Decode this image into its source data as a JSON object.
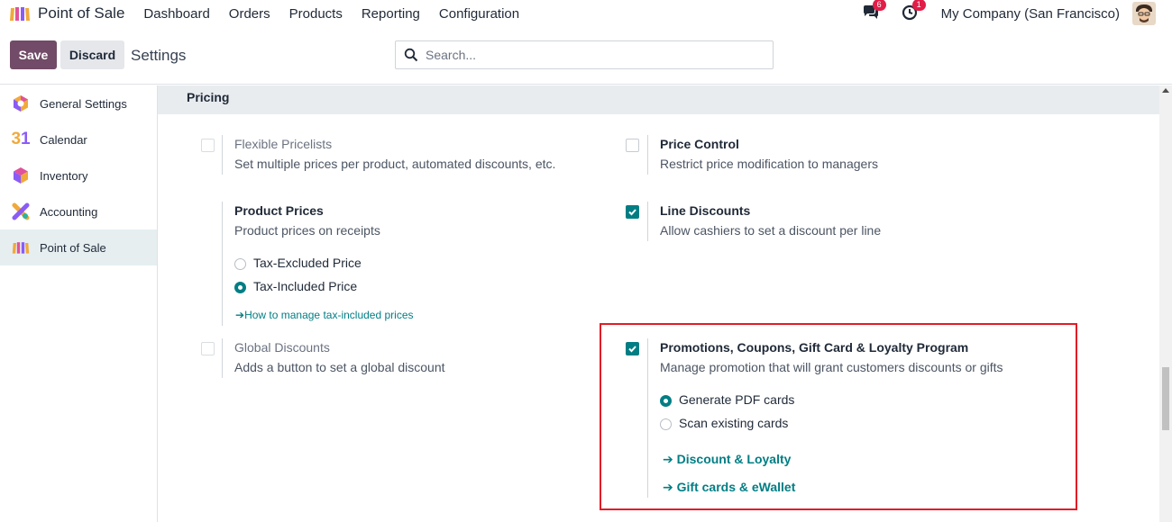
{
  "navbar": {
    "app_name": "Point of Sale",
    "menu": [
      "Dashboard",
      "Orders",
      "Products",
      "Reporting",
      "Configuration"
    ],
    "messages_count": "6",
    "activities_count": "1",
    "company": "My Company (San Francisco)"
  },
  "control": {
    "save_label": "Save",
    "discard_label": "Discard",
    "title": "Settings",
    "search_placeholder": "Search..."
  },
  "sidebar": {
    "items": [
      {
        "label": "General Settings",
        "icon": "general-settings-icon"
      },
      {
        "label": "Calendar",
        "icon": "calendar-icon",
        "icon_text": "31"
      },
      {
        "label": "Inventory",
        "icon": "inventory-icon"
      },
      {
        "label": "Accounting",
        "icon": "accounting-icon"
      },
      {
        "label": "Point of Sale",
        "icon": "point-of-sale-icon",
        "active": true
      }
    ]
  },
  "section": {
    "title": "Pricing"
  },
  "settings": {
    "flexible_pricelists": {
      "title": "Flexible Pricelists",
      "desc": "Set multiple prices per product, automated discounts, etc.",
      "checked": false
    },
    "price_control": {
      "title": "Price Control",
      "desc": "Restrict price modification to managers",
      "checked": false
    },
    "product_prices": {
      "title": "Product Prices",
      "desc": "Product prices on receipts",
      "options": [
        "Tax-Excluded Price",
        "Tax-Included Price"
      ],
      "selected": "Tax-Included Price",
      "link": "How to manage tax-included prices"
    },
    "line_discounts": {
      "title": "Line Discounts",
      "desc": "Allow cashiers to set a discount per line",
      "checked": true
    },
    "global_discounts": {
      "title": "Global Discounts",
      "desc": "Adds a button to set a global discount",
      "checked": false
    },
    "promotions": {
      "title": "Promotions, Coupons, Gift Card & Loyalty Program",
      "desc": "Manage promotion that will grant customers discounts or gifts",
      "checked": true,
      "options": [
        "Generate PDF cards",
        "Scan existing cards"
      ],
      "selected": "Generate PDF cards",
      "links": [
        "Discount & Loyalty",
        "Gift cards & eWallet"
      ]
    }
  },
  "colors": {
    "brand": "#714b67",
    "accent": "#017e84",
    "highlight": "#e11d26"
  }
}
